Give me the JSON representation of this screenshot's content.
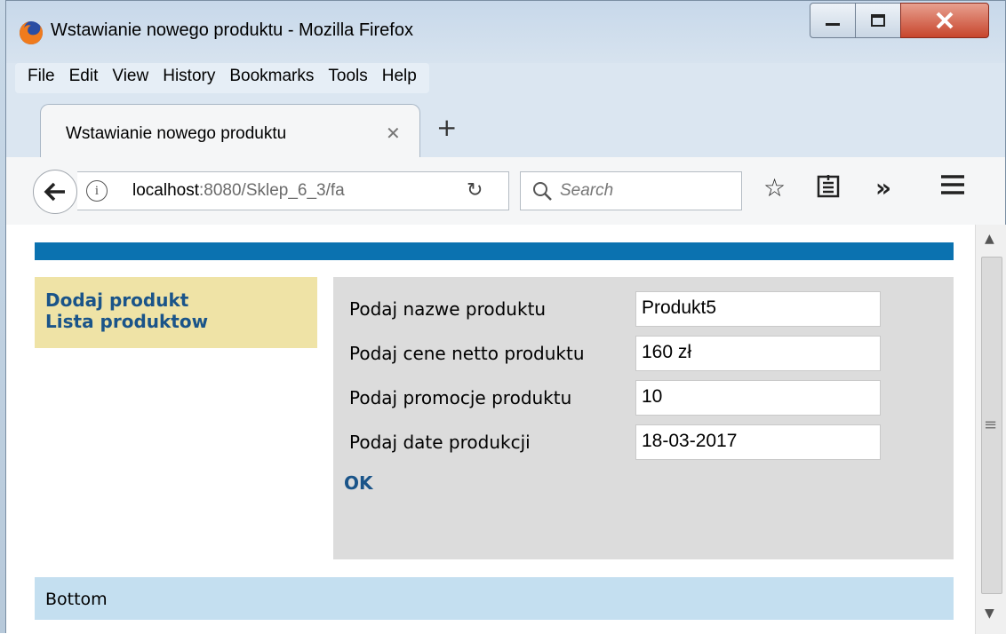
{
  "window": {
    "title": "Wstawianie nowego produktu - Mozilla Firefox",
    "minimize_icon": "minimize-icon",
    "maximize_icon": "maximize-icon",
    "close_icon": "close-icon"
  },
  "menubar": [
    "File",
    "Edit",
    "View",
    "History",
    "Bookmarks",
    "Tools",
    "Help"
  ],
  "tabs": [
    {
      "label": "Wstawianie nowego produktu"
    }
  ],
  "navbar": {
    "url_host": "localhost",
    "url_rest": ":8080/Sklep_6_3/fa",
    "search_placeholder": "Search",
    "overflow_label": "»"
  },
  "page": {
    "colors": {
      "topbar": "#0b72b0",
      "sidebar": "#efe3a6",
      "main": "#dcdcdc",
      "bottom": "#c4dff0",
      "link": "#1a5489"
    },
    "sidebar_links": [
      "Dodaj produkt",
      "Lista produktow"
    ],
    "form": [
      {
        "label": "Podaj nazwe produktu",
        "value": "Produkt5"
      },
      {
        "label": "Podaj cene netto produktu",
        "value": "160 zł"
      },
      {
        "label": "Podaj promocje produktu",
        "value": "10"
      },
      {
        "label": "Podaj date produkcji",
        "value": "18-03-2017"
      }
    ],
    "submit_label": "OK",
    "footer": "Bottom"
  }
}
